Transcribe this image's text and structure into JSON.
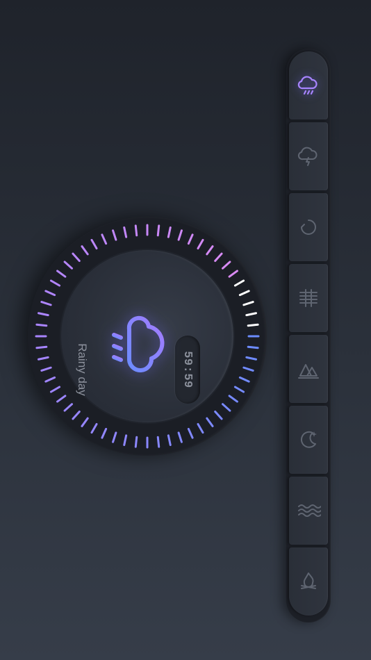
{
  "timer": {
    "remaining": "59:59",
    "progress": 0.08
  },
  "weather": {
    "label": "Rainy day",
    "icon": "cloud-rain-icon"
  },
  "scenes": [
    {
      "id": "rainy-day",
      "icon": "cloud-rain-icon",
      "active": true
    },
    {
      "id": "thunderstorm",
      "icon": "cloud-lightning-icon",
      "active": false
    },
    {
      "id": "wind",
      "icon": "wind-spiral-icon",
      "active": false
    },
    {
      "id": "fog",
      "icon": "fog-lines-icon",
      "active": false
    },
    {
      "id": "forest",
      "icon": "forest-trees-icon",
      "active": false
    },
    {
      "id": "night",
      "icon": "crescent-moon-icon",
      "active": false
    },
    {
      "id": "ocean",
      "icon": "waves-icon",
      "active": false
    },
    {
      "id": "fireplace",
      "icon": "campfire-icon",
      "active": false
    }
  ],
  "colors": {
    "accent_blue": "#6b8cff",
    "accent_purple": "#a884ff",
    "accent_pink": "#e78cf0",
    "tick_done": "#ffffff",
    "icon_inactive": "#5f6571"
  }
}
